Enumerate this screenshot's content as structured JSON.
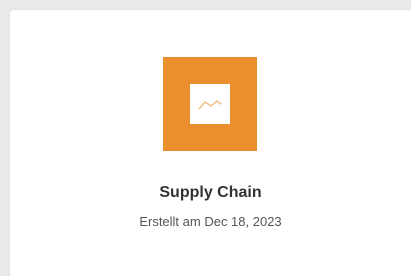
{
  "card": {
    "title": "Supply Chain",
    "created": "Erstellt am Dec 18, 2023",
    "thumbnail_icon": "line-chart-icon",
    "colors": {
      "thumbnail_bg": "#e98f2d",
      "icon_stroke": "#f2b26d"
    }
  }
}
